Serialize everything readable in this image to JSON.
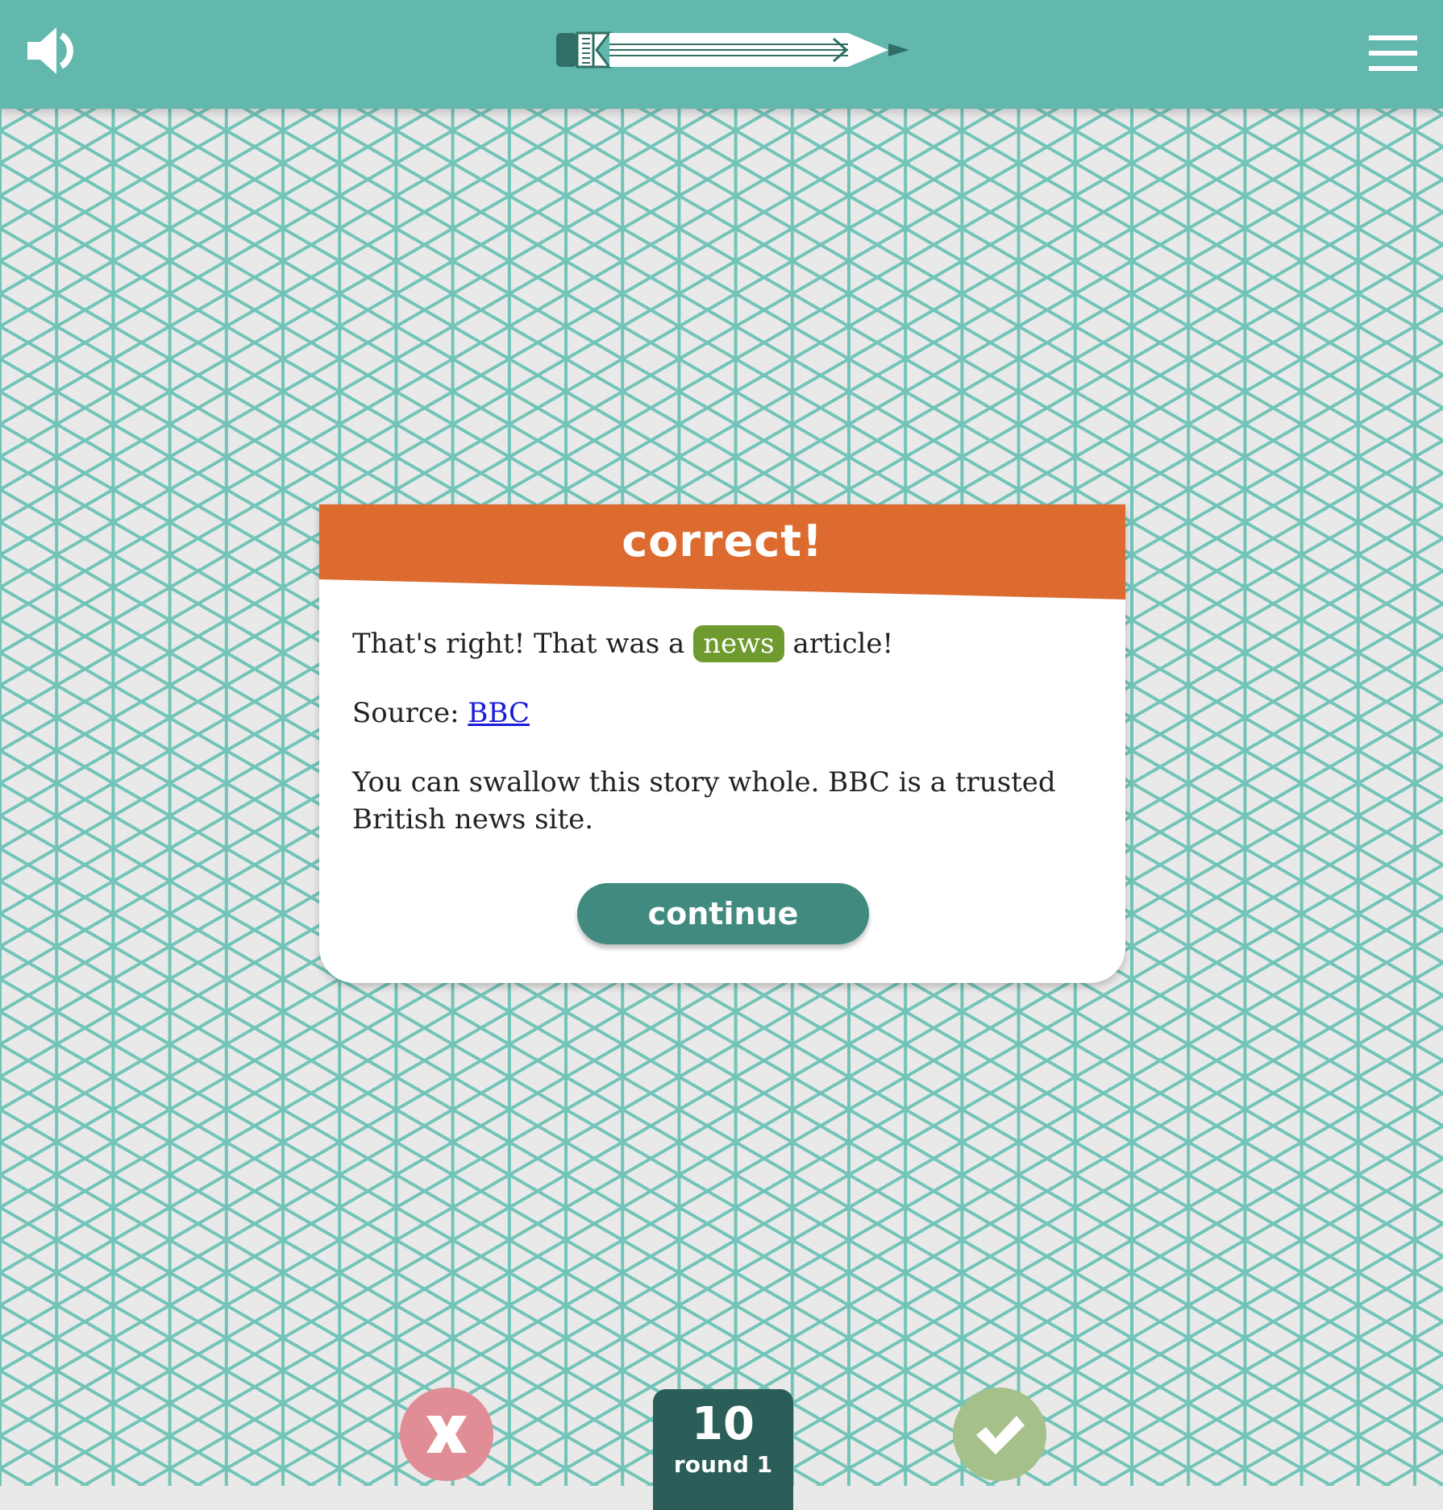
{
  "header": {
    "sound_icon": "speaker-icon",
    "logo_icon": "pencil-logo-icon",
    "menu_icon": "hamburger-menu-icon"
  },
  "dialog": {
    "title": "correct!",
    "line1_prefix": "That's right! That was a",
    "category_tag": "news",
    "line1_suffix": "article!",
    "source_label": "Source:",
    "source_link": "BBC",
    "explanation": "You can swallow this story whole. BBC is a trusted British news site.",
    "continue_label": "continue"
  },
  "bottom": {
    "wrong_icon": "x-icon",
    "right_icon": "checkmark-icon",
    "score": "10",
    "round_label": "round 1"
  },
  "colors": {
    "topbar": "#63b8ae",
    "pattern_lines": "#72c4b8",
    "background": "#e9e9e9",
    "dialog_header": "#dd6b2f",
    "news_tag": "#6e9a2e",
    "continue_button": "#418a80",
    "score_box": "#2b5e58",
    "wrong_button": "#e08d95",
    "right_button": "#a6c08a"
  }
}
